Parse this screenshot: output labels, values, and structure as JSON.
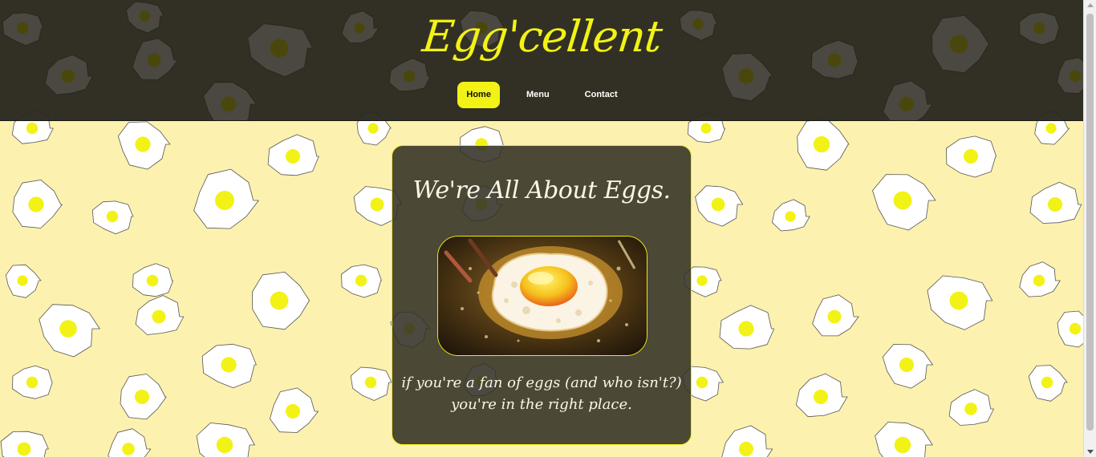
{
  "site": {
    "title": "Egg'cellent"
  },
  "nav": {
    "items": [
      {
        "label": "Home",
        "active": true
      },
      {
        "label": "Menu",
        "active": false
      },
      {
        "label": "Contact",
        "active": false
      }
    ]
  },
  "hero": {
    "heading": "We're All About Eggs.",
    "image_alt": "fried-egg-illustration",
    "text": "if you're a fan of eggs (and who isn't?) you're in the right place."
  },
  "colors": {
    "accent": "#f2f216",
    "background": "#fcf1ae",
    "header": "#2a281e",
    "card": "#323026"
  }
}
